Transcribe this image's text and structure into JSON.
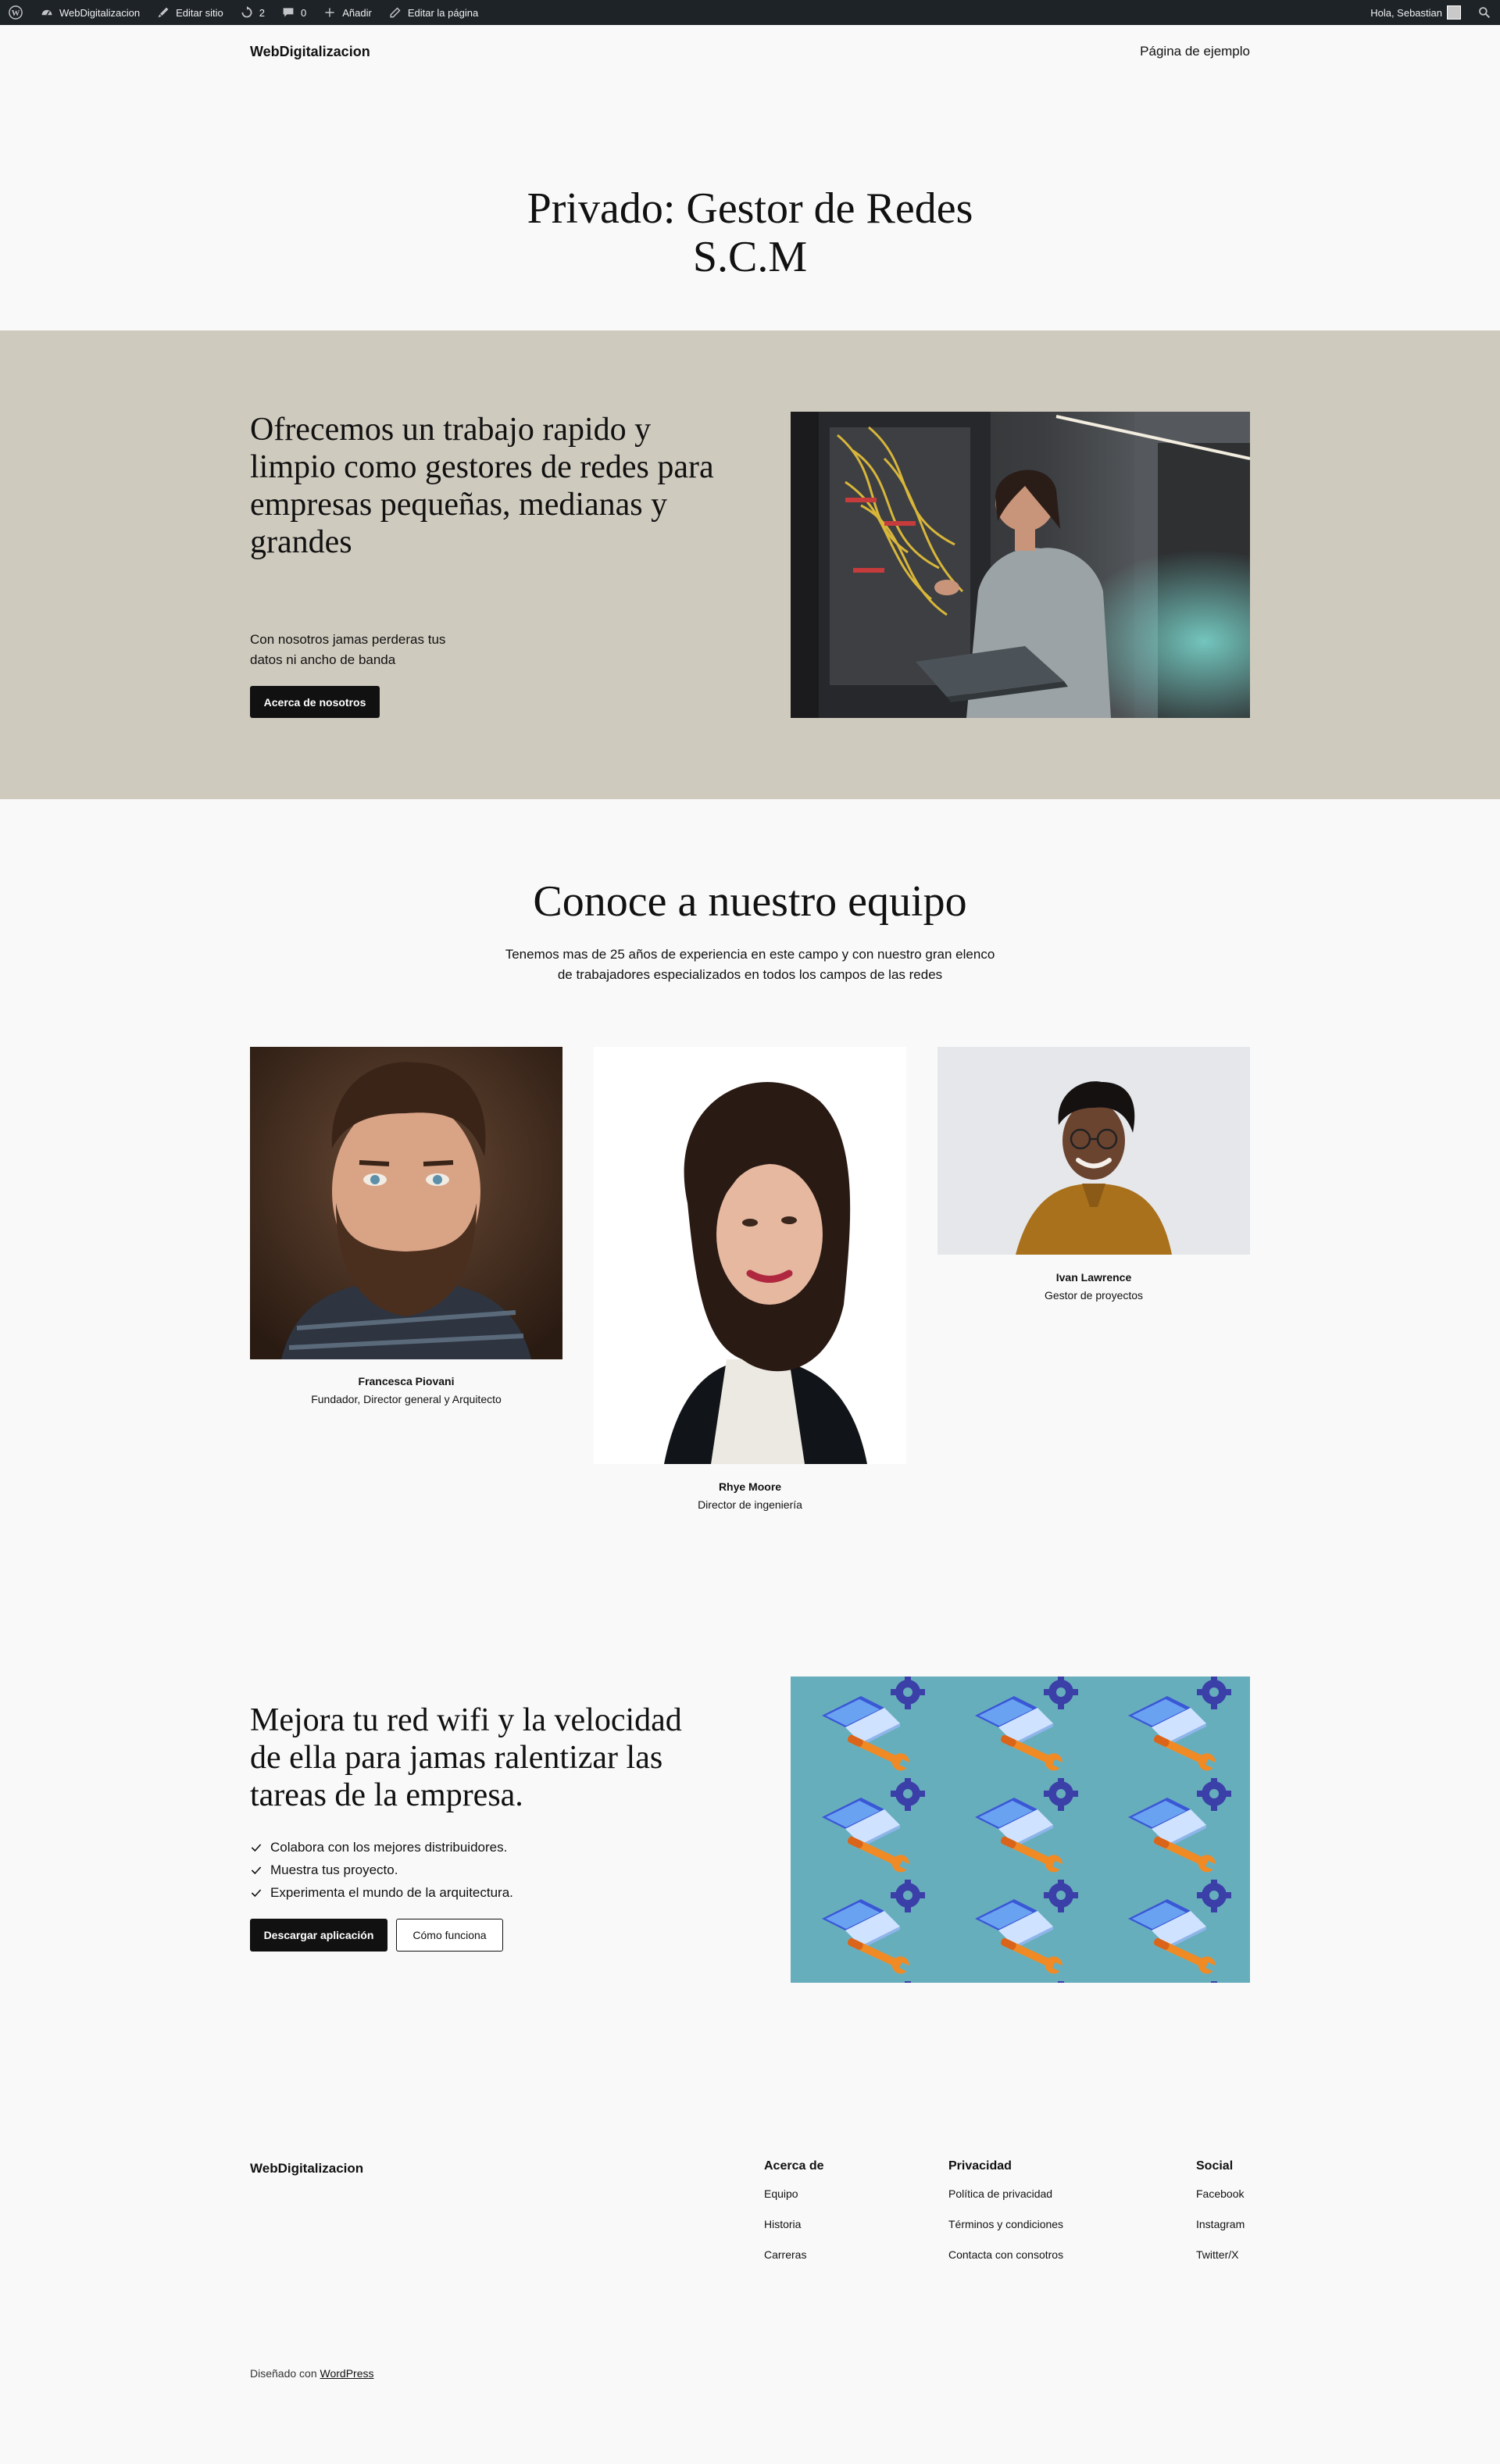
{
  "admin_bar": {
    "site_name": "WebDigitalizacion",
    "edit_site": "Editar sitio",
    "updates_count": "2",
    "comments_count": "0",
    "add_new": "Añadir",
    "edit_page": "Editar la página",
    "greeting": "Hola, Sebastian"
  },
  "header": {
    "site_title": "WebDigitalizacion",
    "nav_link": "Página de ejemplo"
  },
  "page": {
    "title_line1": "Privado: Gestor de Redes",
    "title_line2": "S.C.M"
  },
  "hero": {
    "heading": "Ofrecemos un trabajo rapido y limpio como gestores de redes para empresas pequeñas, medianas y grandes",
    "text": "Con nosotros jamas perderas tus datos ni ancho de banda",
    "button": "Acerca de nosotros",
    "background_color": "#cfcabe"
  },
  "team": {
    "heading": "Conoce a nuestro equipo",
    "intro": "Tenemos mas de 25 años de experiencia en este campo y con nuestro gran elenco de trabajadores especializados en todos los campos de las redes",
    "members": [
      {
        "name": "Francesca Piovani",
        "role": "Fundador, Director general y Arquitecto"
      },
      {
        "name": "Rhye Moore",
        "role": "Director de ingeniería"
      },
      {
        "name": "Ivan Lawrence",
        "role": "Gestor de proyectos"
      }
    ]
  },
  "wifi": {
    "heading": "Mejora tu red wifi y la velocidad de ella para jamas ralentizar las tareas de la empresa.",
    "items": [
      "Colabora con los mejores distribuidores.",
      "Muestra tus proyecto.",
      "Experimenta el mundo de la arquitectura."
    ],
    "primary_button": "Descargar aplicación",
    "secondary_button": "Cómo funciona"
  },
  "footer": {
    "site_title": "WebDigitalizacion",
    "columns": [
      {
        "title": "Acerca de",
        "links": [
          "Equipo",
          "Historia",
          "Carreras"
        ]
      },
      {
        "title": "Privacidad",
        "links": [
          "Política de privacidad",
          "Términos y condiciones",
          "Contacta con consotros"
        ]
      },
      {
        "title": "Social",
        "links": [
          "Facebook",
          "Instagram",
          "Twitter/X"
        ]
      }
    ],
    "credit_prefix": "Diseñado con",
    "credit_link": "WordPress"
  }
}
